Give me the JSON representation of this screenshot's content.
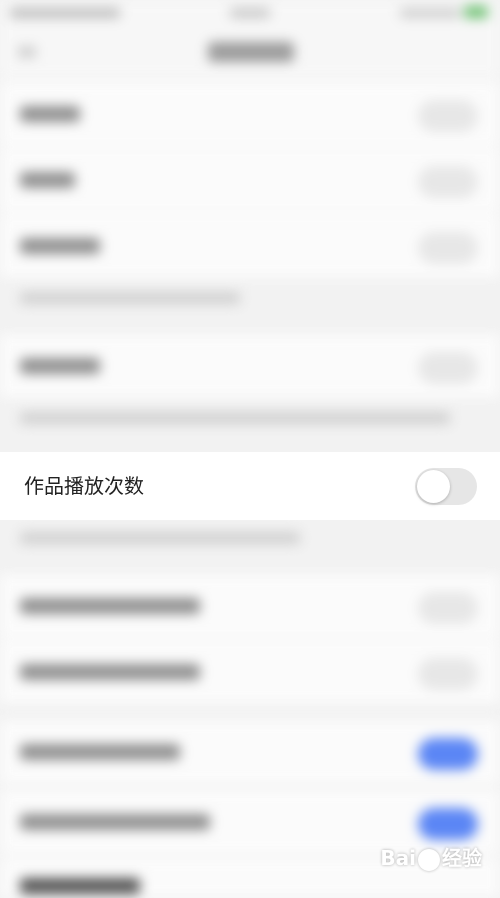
{
  "setting": {
    "label": "作品播放次数",
    "toggle_state": "off"
  },
  "watermark": {
    "brand_left": "Bai",
    "brand_right": "经验"
  },
  "colors": {
    "toggle_on": "#5b86f5",
    "toggle_off": "#e6e6e6"
  },
  "icons": {
    "watermark_logo": "paw-icon"
  }
}
